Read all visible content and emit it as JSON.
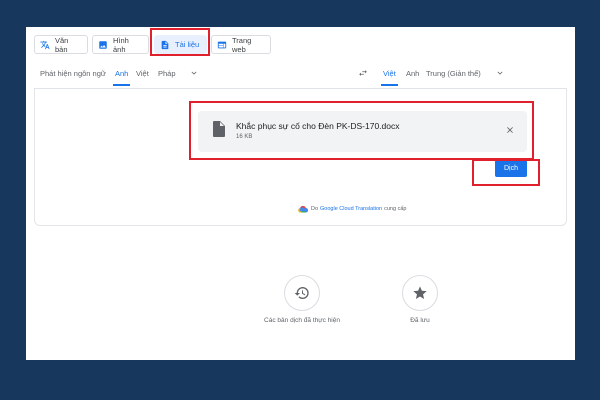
{
  "mode_tabs": [
    {
      "label": "Văn bản",
      "icon": "translate-icon"
    },
    {
      "label": "Hình ảnh",
      "icon": "image-icon"
    },
    {
      "label": "Tài liệu",
      "icon": "document-icon",
      "selected": true
    },
    {
      "label": "Trang web",
      "icon": "web-icon"
    }
  ],
  "source_langs": [
    "Phát hiện ngôn ngữ",
    "Anh",
    "Việt",
    "Pháp"
  ],
  "target_langs": [
    "Việt",
    "Anh",
    "Trung (Giản thể)"
  ],
  "file": {
    "name": "Khắc phục sự cố cho Đèn PK-DS-170.docx",
    "size": "16 KB"
  },
  "translate_button": "Dịch",
  "powered_by": {
    "prefix": "Do",
    "brand": "Google Cloud Translation",
    "suffix": "cung cấp"
  },
  "history_label": "Các bản dịch đã thực hiện",
  "saved_label": "Đã lưu",
  "colors": {
    "background": "#17375c",
    "accent": "#1a73e8",
    "highlight": "#e0212d"
  }
}
